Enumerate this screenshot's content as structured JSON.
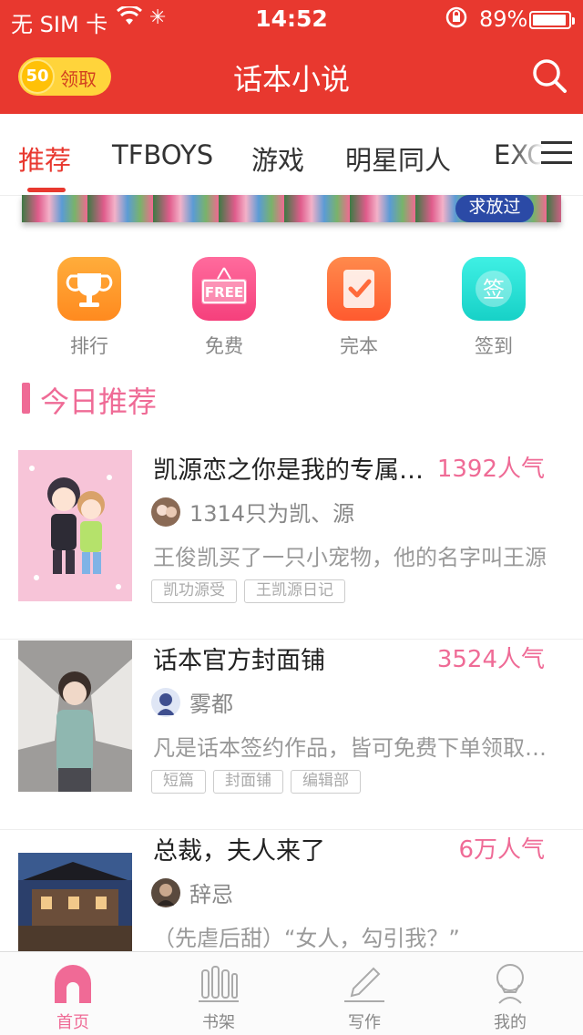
{
  "status_bar": {
    "carrier": "无 SIM 卡",
    "time": "14:52",
    "battery_pct": "89%",
    "battery_level": 0.89,
    "icons": [
      "wifi-icon",
      "loading-spinner-icon",
      "orientation-lock-icon",
      "battery-icon"
    ]
  },
  "header": {
    "app_title": "话本小说",
    "coin_amount": "50",
    "claim_label": "领取",
    "colors": {
      "header_bg": "#e8382f",
      "coin": "#ffd43b",
      "accent_pink": "#ef6b96"
    }
  },
  "tabs": [
    {
      "label": "推荐",
      "active": true
    },
    {
      "label": "TFBOYS",
      "active": false
    },
    {
      "label": "游戏",
      "active": false
    },
    {
      "label": "明星同人",
      "active": false
    },
    {
      "label": "EXO",
      "active": false
    }
  ],
  "banner": {
    "badge_text": "求放过"
  },
  "quick_entries": [
    {
      "label": "排行",
      "icon": "trophy-icon"
    },
    {
      "label": "免费",
      "icon": "free-sign-icon"
    },
    {
      "label": "完本",
      "icon": "checklist-icon"
    },
    {
      "label": "签到",
      "icon": "sign-in-icon",
      "icon_text": "签"
    }
  ],
  "free_sign_text": "FREE",
  "section": {
    "title": "今日推荐"
  },
  "books": [
    {
      "title": "凯源恋之你是我的专属宠物",
      "popularity": "1392人气",
      "author": "1314只为凯、源",
      "description": "王俊凯买了一只小宠物，他的名字叫王源",
      "tags": [
        "凯功源受",
        "王凯源日记"
      ]
    },
    {
      "title": "话本官方封面铺",
      "popularity": "3524人气",
      "author": "雾都",
      "description": "凡是话本签约作品，皆可免费下单领取封面",
      "tags": [
        "短篇",
        "封面铺",
        "编辑部"
      ]
    },
    {
      "title": "总裁，夫人来了",
      "popularity": "6万人气",
      "author": "辞忌",
      "description": "（先虐后甜）“女人，勾引我？”",
      "tags": []
    }
  ],
  "tabbar": [
    {
      "label": "首页",
      "icon": "home-icon",
      "active": true
    },
    {
      "label": "书架",
      "icon": "bookshelf-icon",
      "active": false
    },
    {
      "label": "写作",
      "icon": "pen-icon",
      "active": false
    },
    {
      "label": "我的",
      "icon": "profile-icon",
      "active": false
    }
  ]
}
